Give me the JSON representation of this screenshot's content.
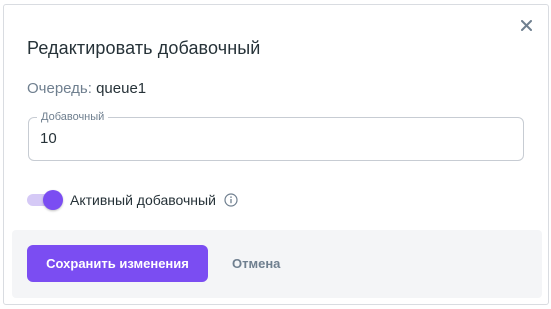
{
  "dialog": {
    "title": "Редактировать добавочный",
    "close_icon": "close-icon"
  },
  "queue": {
    "label": "Очередь:",
    "value": "queue1"
  },
  "extension_field": {
    "label": "Добавочный",
    "value": "10"
  },
  "active_toggle": {
    "label": "Активный добавочный",
    "checked": true,
    "info_icon": "info-icon"
  },
  "footer": {
    "save_label": "Сохранить изменения",
    "cancel_label": "Отмена"
  },
  "colors": {
    "accent": "#7b4df2",
    "accent_light": "#d5c9f6",
    "muted_text": "#6f7f8f",
    "text": "#263238",
    "footer_bg": "#f4f5f7"
  }
}
